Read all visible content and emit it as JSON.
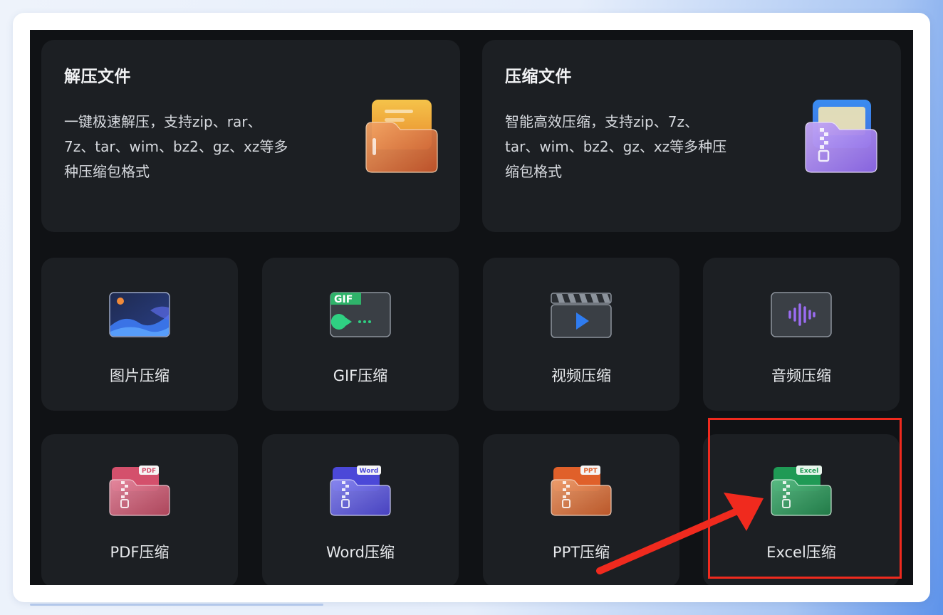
{
  "cards": {
    "extract": {
      "title": "解压文件",
      "desc_lines": [
        "一键极速解压，支持zip、rar、",
        "7z、tar、wim、bz2、gz、xz等多",
        "种压缩包格式"
      ]
    },
    "compress": {
      "title": "压缩文件",
      "desc_lines": [
        "智能高效压缩，支持zip、7z、",
        "tar、wim、bz2、gz、xz等多种压",
        "缩包格式"
      ]
    }
  },
  "tiles": [
    {
      "label": "图片压缩",
      "icon": "image-icon"
    },
    {
      "label": "GIF压缩",
      "icon": "gif-icon",
      "badge": "GIF"
    },
    {
      "label": "视频压缩",
      "icon": "video-clapper-icon"
    },
    {
      "label": "音频压缩",
      "icon": "audio-wave-icon"
    },
    {
      "label": "PDF压缩",
      "icon": "pdf-zip-icon",
      "badge": "PDF"
    },
    {
      "label": "Word压缩",
      "icon": "word-zip-icon",
      "badge": "Word"
    },
    {
      "label": "PPT压缩",
      "icon": "ppt-zip-icon",
      "badge": "PPT"
    },
    {
      "label": "Excel压缩",
      "icon": "excel-zip-icon",
      "badge": "Excel"
    }
  ],
  "colors": {
    "highlight": "#f02a1e",
    "extract_folder": "#e88a3c",
    "compress_folder": "#a98cf0",
    "pdf": "#e0607a",
    "word": "#5b58e0",
    "ppt": "#e0703a",
    "excel": "#2f9a5e"
  }
}
